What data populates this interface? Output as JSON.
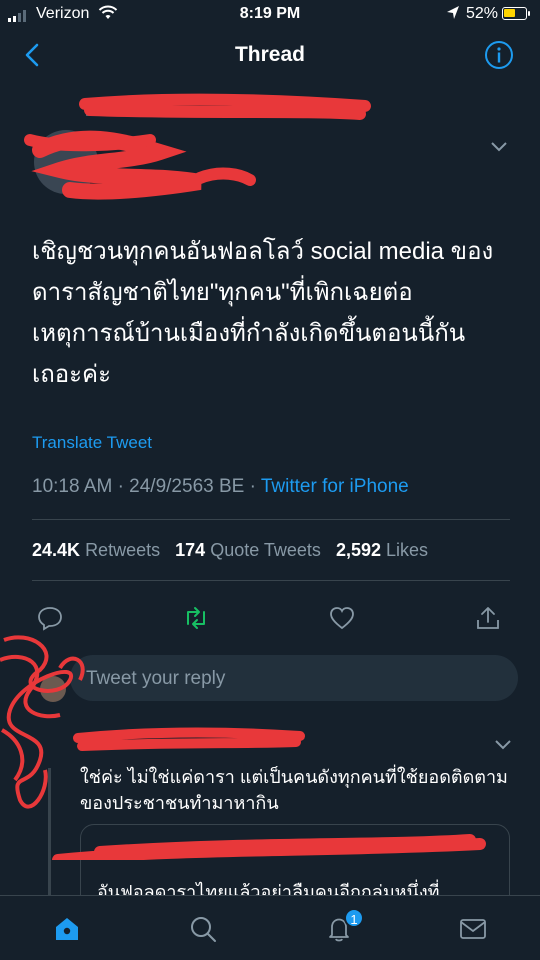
{
  "status_bar": {
    "carrier": "Verizon",
    "time": "8:19 PM",
    "battery": "52%",
    "battery_level": 0.52
  },
  "nav": {
    "title": "Thread"
  },
  "tweet": {
    "text": "เชิญชวนทุกคนอันฟอลโลว์ social media ของดาราสัญชาติไทย\"ทุกคน\"ที่เพิกเฉยต่อเหตุการณ์บ้านเมืองที่กำลังเกิดขึ้นตอนนี้กันเถอะค่ะ",
    "translate_label": "Translate Tweet",
    "time": "10:18 AM",
    "date": "24/9/2563 BE",
    "separator": "·",
    "source": "Twitter for iPhone",
    "stats": {
      "retweets_count": "24.4K",
      "retweets_label": "Retweets",
      "quotes_count": "174",
      "quotes_label": "Quote Tweets",
      "likes_count": "2,592",
      "likes_label": "Likes"
    }
  },
  "reply_box": {
    "placeholder": "Tweet your reply"
  },
  "reply": {
    "text": "ใช่ค่ะ ไม่ใช่แค่ดารา แต่เป็นคนดังทุกคนที่ใช้ยอดติดตามของประชาชนทำมาหากิน",
    "quote_text": "อันฟอลดาราไทยแล้วอย่าลืมคนอีกกลุ่มหนึ่งที่"
  },
  "tabbar": {
    "notifications_badge": "1"
  },
  "colors": {
    "background": "#15202b",
    "accent": "#1d9bf0",
    "retweet_active": "#17bf63",
    "muted": "#8899a6",
    "redaction": "#e8383a"
  }
}
